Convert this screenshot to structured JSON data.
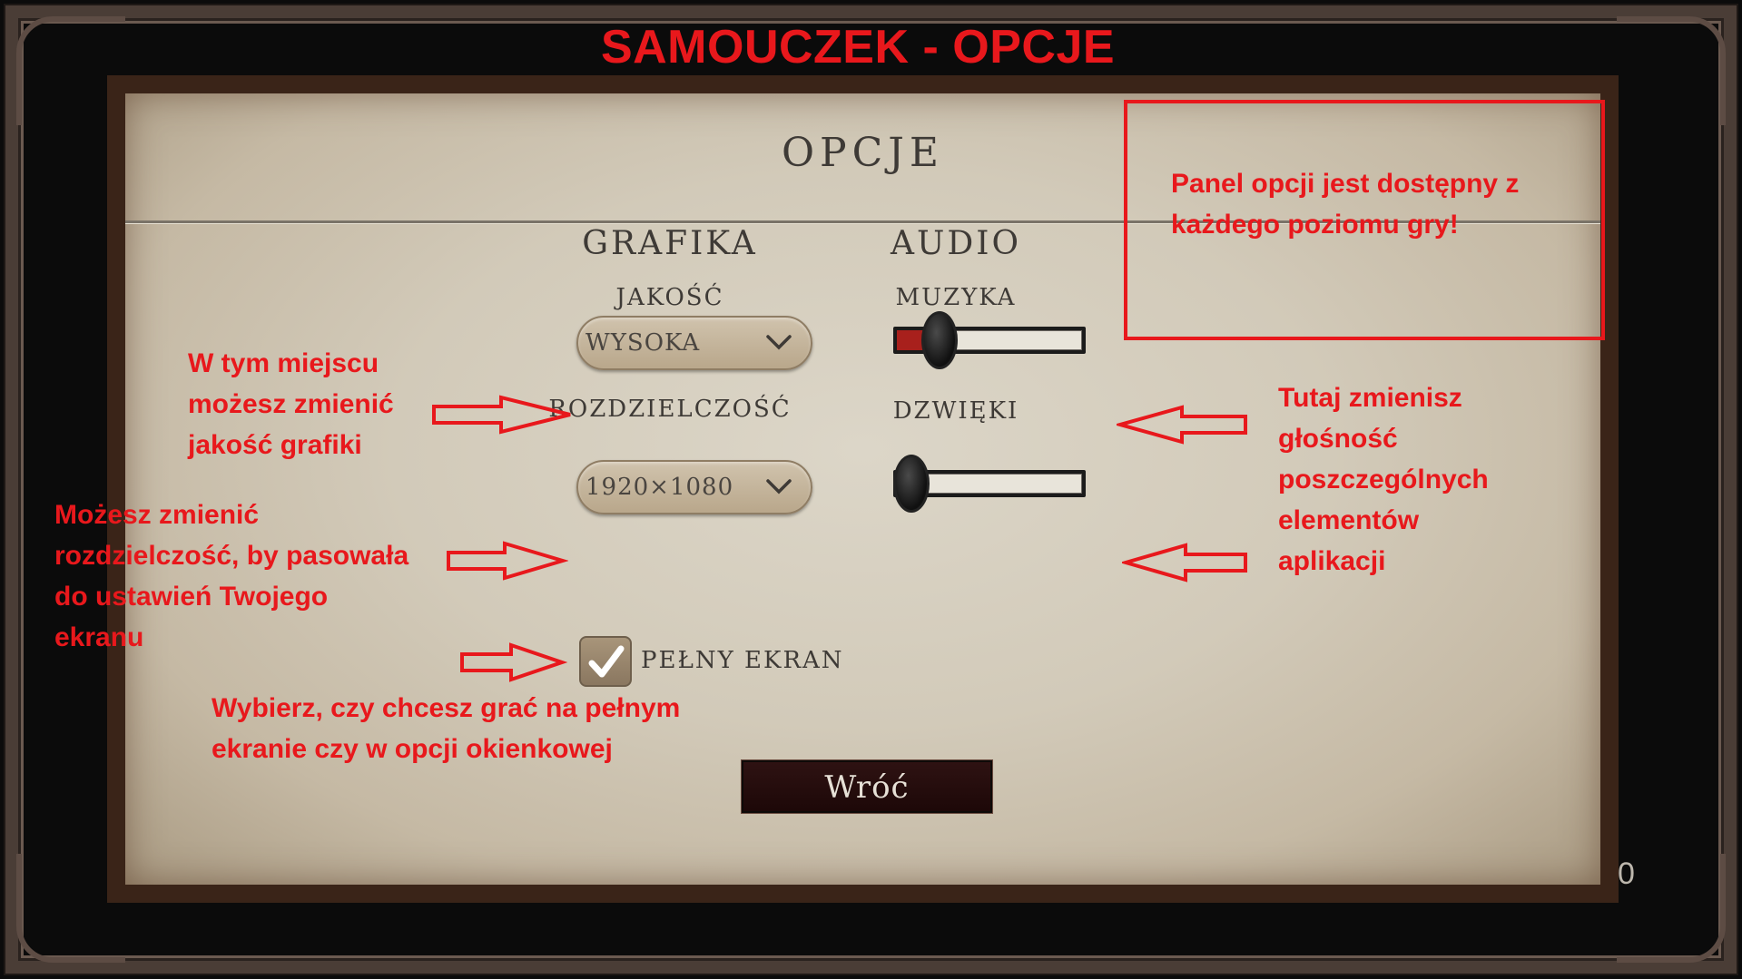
{
  "page_title": "SAMOUCZEK - OPCJE",
  "panel": {
    "title": "OPCJE",
    "graphics": {
      "heading": "GRAFIKA",
      "quality_label": "JAKOŚĆ",
      "quality_value": "WYSOKA",
      "resolution_label": "ROZDZIELCZOŚĆ",
      "resolution_value": "1920×1080"
    },
    "audio": {
      "heading": "AUDIO",
      "music_label": "MUZYKA",
      "music_level": 0.15,
      "sounds_label": "DZWIĘKI",
      "sounds_level": 0.0
    },
    "fullscreen": {
      "label": "PEŁNY EKRAN",
      "checked": true
    },
    "back_label": "Wróć"
  },
  "annotations": {
    "callout": [
      "Panel opcji jest dostępny z",
      "każdego poziomu gry!"
    ],
    "quality": [
      "W tym miejscu",
      "możesz zmienić",
      "jakość grafiki"
    ],
    "resolution": [
      "Możesz zmienić",
      "rozdzielczość, by pasowała",
      "do ustawień Twojego",
      "ekranu"
    ],
    "fullscreen": [
      "Wybierz, czy chcesz grać na pełnym",
      "ekranie czy w opcji okienkowej"
    ],
    "audio": [
      "Tutaj zmienisz",
      "głośność",
      "poszczególnych",
      "elementów",
      "aplikacji"
    ]
  },
  "stray_text": "0",
  "colors": {
    "annotation": "#e8181c",
    "slider_fill": "#a8201c"
  }
}
